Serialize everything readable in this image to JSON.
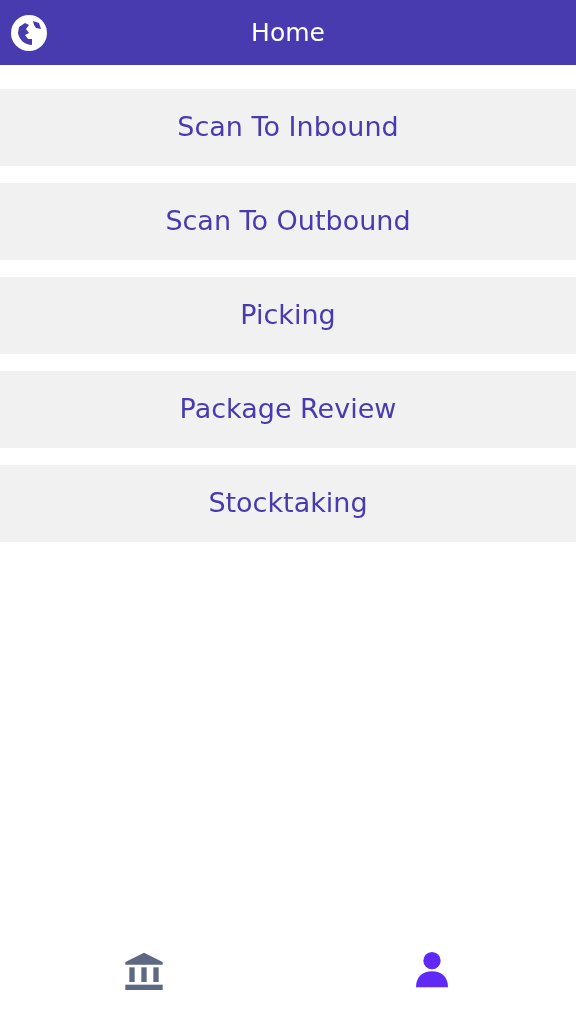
{
  "header": {
    "title": "Home"
  },
  "menu": [
    {
      "label": "Scan To Inbound"
    },
    {
      "label": "Scan To Outbound"
    },
    {
      "label": "Picking"
    },
    {
      "label": "Package Review"
    },
    {
      "label": "Stocktaking"
    }
  ],
  "bottom_tabs": [
    {
      "kind": "bank",
      "selected": false
    },
    {
      "kind": "person",
      "selected": true
    }
  ]
}
